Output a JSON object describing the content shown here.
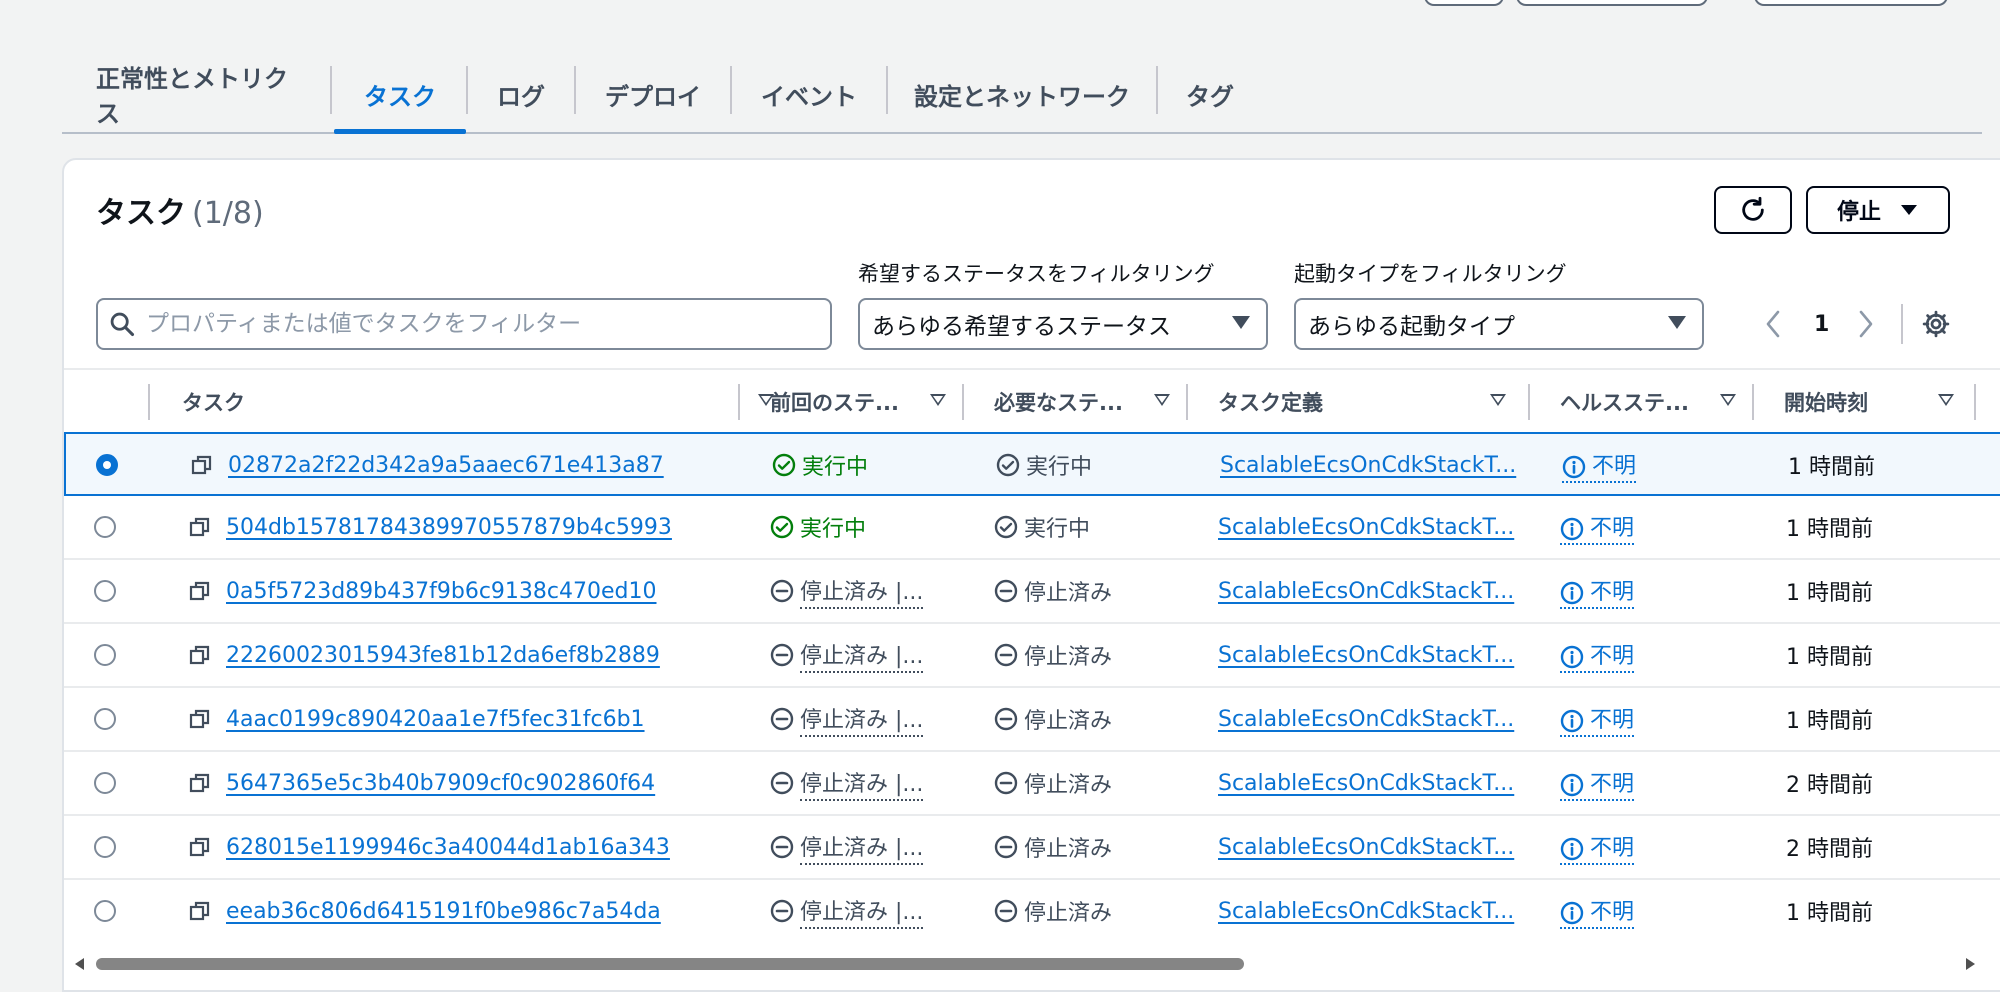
{
  "tabs": [
    "正常性とメトリクス",
    "タスク",
    "ログ",
    "デプロイ",
    "イベント",
    "設定とネットワーク",
    "タグ"
  ],
  "active_tab_index": 1,
  "panel": {
    "title": "タスク",
    "count": "(1/8)",
    "stop_button": "停止",
    "search_placeholder": "プロパティまたは値でタスクをフィルター",
    "desired_status_label": "希望するステータスをフィルタリング",
    "desired_status_value": "あらゆる希望するステータス",
    "launch_type_label": "起動タイプをフィルタリング",
    "launch_type_value": "あらゆる起動タイプ",
    "page_number": "1"
  },
  "columns": [
    "タスク",
    "前回のステ...",
    "必要なステ...",
    "タスク定義",
    "ヘルスステ...",
    "開始時刻"
  ],
  "rows": [
    {
      "id": "02872a2f22d342a9a5aaec671e413a87",
      "last": "実行中",
      "desired": "実行中",
      "def": "ScalableEcsOnCdkStackT...",
      "health": "不明",
      "started": "1 時間前",
      "selected": true
    },
    {
      "id": "504db157817843899705578 79b4c5993",
      "last": "実行中",
      "desired": "実行中",
      "def": "ScalableEcsOnCdkStackT...",
      "health": "不明",
      "started": "1 時間前",
      "selected": false
    },
    {
      "id": "0a5f5723d89b437f9b6c9138c470ed10",
      "last": "停止済み |...",
      "desired": "停止済み",
      "def": "ScalableEcsOnCdkStackT...",
      "health": "不明",
      "started": "1 時間前",
      "selected": false
    },
    {
      "id": "22260023015943fe81b12da6ef8b2889",
      "last": "停止済み |...",
      "desired": "停止済み",
      "def": "ScalableEcsOnCdkStackT...",
      "health": "不明",
      "started": "1 時間前",
      "selected": false
    },
    {
      "id": "4aac0199c890420aa1e7f5fec31fc6b1",
      "last": "停止済み |...",
      "desired": "停止済み",
      "def": "ScalableEcsOnCdkStackT...",
      "health": "不明",
      "started": "1 時間前",
      "selected": false
    },
    {
      "id": "5647365e5c3b40b7909cf0c902860f64",
      "last": "停止済み |...",
      "desired": "停止済み",
      "def": "ScalableEcsOnCdkStackT...",
      "health": "不明",
      "started": "2 時間前",
      "selected": false
    },
    {
      "id": "628015e1199946c3a40044d1ab16a343",
      "last": "停止済み |...",
      "desired": "停止済み",
      "def": "ScalableEcsOnCdkStackT...",
      "health": "不明",
      "started": "2 時間前",
      "selected": false
    },
    {
      "id": "eeab36c806d6415191f0be986c7a54da",
      "last": "停止済み |...",
      "desired": "停止済み",
      "def": "ScalableEcsOnCdkStackT...",
      "health": "不明",
      "started": "1 時間前",
      "selected": false
    }
  ],
  "colors": {
    "link": "#0972d3",
    "success": "#037f0c",
    "border": "#7d8998"
  }
}
